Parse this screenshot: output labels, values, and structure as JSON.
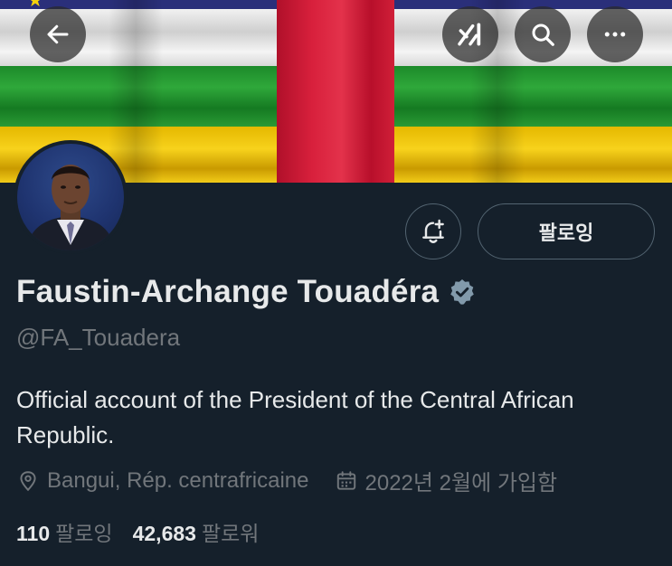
{
  "header": {
    "back_icon": "arrow-left-icon",
    "grok_icon": "grok-icon",
    "search_icon": "search-icon",
    "more_icon": "more-horizontal-icon"
  },
  "profile": {
    "name": "Faustin-Archange Touadéra",
    "handle": "@FA_Touadera",
    "bio": "Official account of the President of the Central African Republic.",
    "location": "Bangui, Rép. centrafricaine",
    "joined": "2022년 2월에 가입함",
    "following_count": "110",
    "following_label": "팔로잉",
    "followers_count": "42,683",
    "followers_label": "팔로워"
  },
  "actions": {
    "follow_label": "팔로잉",
    "notify_icon": "bell-plus-icon"
  },
  "colors": {
    "background": "#15202b",
    "text_primary": "#e7e9ea",
    "text_secondary": "#71767b",
    "verified_badge": "#829aab"
  }
}
